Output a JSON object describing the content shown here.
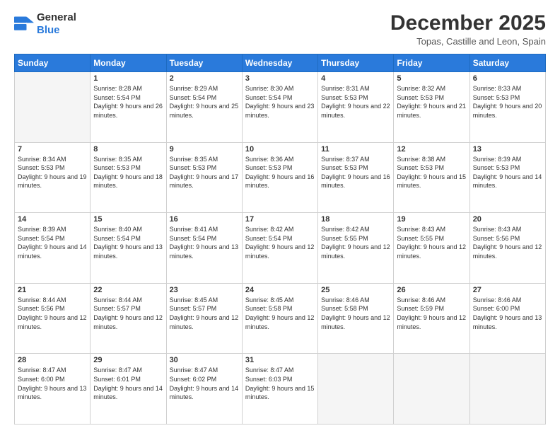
{
  "header": {
    "logo_line1": "General",
    "logo_line2": "Blue",
    "month_title": "December 2025",
    "location": "Topas, Castille and Leon, Spain"
  },
  "weekdays": [
    "Sunday",
    "Monday",
    "Tuesday",
    "Wednesday",
    "Thursday",
    "Friday",
    "Saturday"
  ],
  "weeks": [
    [
      {
        "day": "",
        "empty": true
      },
      {
        "day": "1",
        "sunrise": "8:28 AM",
        "sunset": "5:54 PM",
        "daylight": "9 hours and 26 minutes."
      },
      {
        "day": "2",
        "sunrise": "8:29 AM",
        "sunset": "5:54 PM",
        "daylight": "9 hours and 25 minutes."
      },
      {
        "day": "3",
        "sunrise": "8:30 AM",
        "sunset": "5:54 PM",
        "daylight": "9 hours and 23 minutes."
      },
      {
        "day": "4",
        "sunrise": "8:31 AM",
        "sunset": "5:53 PM",
        "daylight": "9 hours and 22 minutes."
      },
      {
        "day": "5",
        "sunrise": "8:32 AM",
        "sunset": "5:53 PM",
        "daylight": "9 hours and 21 minutes."
      },
      {
        "day": "6",
        "sunrise": "8:33 AM",
        "sunset": "5:53 PM",
        "daylight": "9 hours and 20 minutes."
      }
    ],
    [
      {
        "day": "7",
        "sunrise": "8:34 AM",
        "sunset": "5:53 PM",
        "daylight": "9 hours and 19 minutes."
      },
      {
        "day": "8",
        "sunrise": "8:35 AM",
        "sunset": "5:53 PM",
        "daylight": "9 hours and 18 minutes."
      },
      {
        "day": "9",
        "sunrise": "8:35 AM",
        "sunset": "5:53 PM",
        "daylight": "9 hours and 17 minutes."
      },
      {
        "day": "10",
        "sunrise": "8:36 AM",
        "sunset": "5:53 PM",
        "daylight": "9 hours and 16 minutes."
      },
      {
        "day": "11",
        "sunrise": "8:37 AM",
        "sunset": "5:53 PM",
        "daylight": "9 hours and 16 minutes."
      },
      {
        "day": "12",
        "sunrise": "8:38 AM",
        "sunset": "5:53 PM",
        "daylight": "9 hours and 15 minutes."
      },
      {
        "day": "13",
        "sunrise": "8:39 AM",
        "sunset": "5:53 PM",
        "daylight": "9 hours and 14 minutes."
      }
    ],
    [
      {
        "day": "14",
        "sunrise": "8:39 AM",
        "sunset": "5:54 PM",
        "daylight": "9 hours and 14 minutes."
      },
      {
        "day": "15",
        "sunrise": "8:40 AM",
        "sunset": "5:54 PM",
        "daylight": "9 hours and 13 minutes."
      },
      {
        "day": "16",
        "sunrise": "8:41 AM",
        "sunset": "5:54 PM",
        "daylight": "9 hours and 13 minutes."
      },
      {
        "day": "17",
        "sunrise": "8:42 AM",
        "sunset": "5:54 PM",
        "daylight": "9 hours and 12 minutes."
      },
      {
        "day": "18",
        "sunrise": "8:42 AM",
        "sunset": "5:55 PM",
        "daylight": "9 hours and 12 minutes."
      },
      {
        "day": "19",
        "sunrise": "8:43 AM",
        "sunset": "5:55 PM",
        "daylight": "9 hours and 12 minutes."
      },
      {
        "day": "20",
        "sunrise": "8:43 AM",
        "sunset": "5:56 PM",
        "daylight": "9 hours and 12 minutes."
      }
    ],
    [
      {
        "day": "21",
        "sunrise": "8:44 AM",
        "sunset": "5:56 PM",
        "daylight": "9 hours and 12 minutes."
      },
      {
        "day": "22",
        "sunrise": "8:44 AM",
        "sunset": "5:57 PM",
        "daylight": "9 hours and 12 minutes."
      },
      {
        "day": "23",
        "sunrise": "8:45 AM",
        "sunset": "5:57 PM",
        "daylight": "9 hours and 12 minutes."
      },
      {
        "day": "24",
        "sunrise": "8:45 AM",
        "sunset": "5:58 PM",
        "daylight": "9 hours and 12 minutes."
      },
      {
        "day": "25",
        "sunrise": "8:46 AM",
        "sunset": "5:58 PM",
        "daylight": "9 hours and 12 minutes."
      },
      {
        "day": "26",
        "sunrise": "8:46 AM",
        "sunset": "5:59 PM",
        "daylight": "9 hours and 12 minutes."
      },
      {
        "day": "27",
        "sunrise": "8:46 AM",
        "sunset": "6:00 PM",
        "daylight": "9 hours and 13 minutes."
      }
    ],
    [
      {
        "day": "28",
        "sunrise": "8:47 AM",
        "sunset": "6:00 PM",
        "daylight": "9 hours and 13 minutes."
      },
      {
        "day": "29",
        "sunrise": "8:47 AM",
        "sunset": "6:01 PM",
        "daylight": "9 hours and 14 minutes."
      },
      {
        "day": "30",
        "sunrise": "8:47 AM",
        "sunset": "6:02 PM",
        "daylight": "9 hours and 14 minutes."
      },
      {
        "day": "31",
        "sunrise": "8:47 AM",
        "sunset": "6:03 PM",
        "daylight": "9 hours and 15 minutes."
      },
      {
        "day": "",
        "empty": true
      },
      {
        "day": "",
        "empty": true
      },
      {
        "day": "",
        "empty": true
      }
    ]
  ]
}
